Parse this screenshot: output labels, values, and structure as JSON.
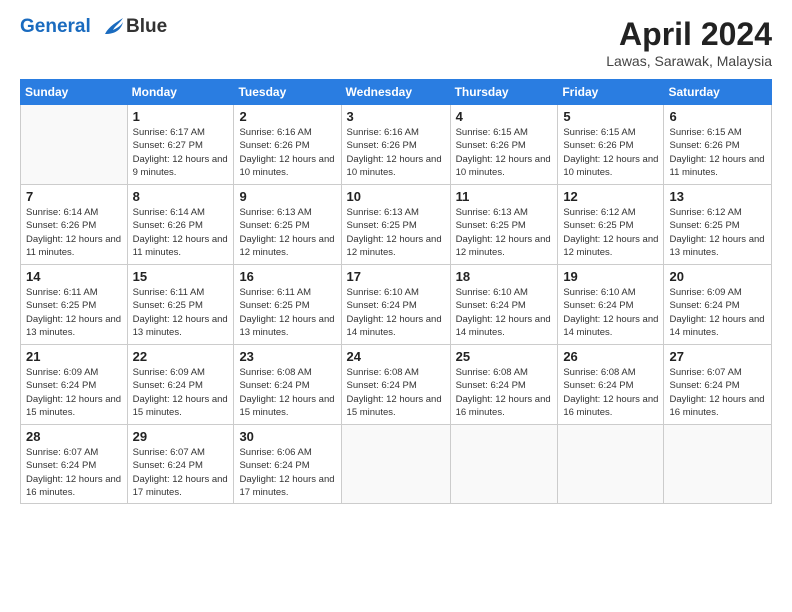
{
  "header": {
    "logo_line1": "General",
    "logo_line2": "Blue",
    "title": "April 2024",
    "subtitle": "Lawas, Sarawak, Malaysia"
  },
  "weekdays": [
    "Sunday",
    "Monday",
    "Tuesday",
    "Wednesday",
    "Thursday",
    "Friday",
    "Saturday"
  ],
  "weeks": [
    [
      {
        "day": "",
        "sunrise": "",
        "sunset": "",
        "daylight": ""
      },
      {
        "day": "1",
        "sunrise": "Sunrise: 6:17 AM",
        "sunset": "Sunset: 6:27 PM",
        "daylight": "Daylight: 12 hours and 9 minutes."
      },
      {
        "day": "2",
        "sunrise": "Sunrise: 6:16 AM",
        "sunset": "Sunset: 6:26 PM",
        "daylight": "Daylight: 12 hours and 10 minutes."
      },
      {
        "day": "3",
        "sunrise": "Sunrise: 6:16 AM",
        "sunset": "Sunset: 6:26 PM",
        "daylight": "Daylight: 12 hours and 10 minutes."
      },
      {
        "day": "4",
        "sunrise": "Sunrise: 6:15 AM",
        "sunset": "Sunset: 6:26 PM",
        "daylight": "Daylight: 12 hours and 10 minutes."
      },
      {
        "day": "5",
        "sunrise": "Sunrise: 6:15 AM",
        "sunset": "Sunset: 6:26 PM",
        "daylight": "Daylight: 12 hours and 10 minutes."
      },
      {
        "day": "6",
        "sunrise": "Sunrise: 6:15 AM",
        "sunset": "Sunset: 6:26 PM",
        "daylight": "Daylight: 12 hours and 11 minutes."
      }
    ],
    [
      {
        "day": "7",
        "sunrise": "Sunrise: 6:14 AM",
        "sunset": "Sunset: 6:26 PM",
        "daylight": "Daylight: 12 hours and 11 minutes."
      },
      {
        "day": "8",
        "sunrise": "Sunrise: 6:14 AM",
        "sunset": "Sunset: 6:26 PM",
        "daylight": "Daylight: 12 hours and 11 minutes."
      },
      {
        "day": "9",
        "sunrise": "Sunrise: 6:13 AM",
        "sunset": "Sunset: 6:25 PM",
        "daylight": "Daylight: 12 hours and 12 minutes."
      },
      {
        "day": "10",
        "sunrise": "Sunrise: 6:13 AM",
        "sunset": "Sunset: 6:25 PM",
        "daylight": "Daylight: 12 hours and 12 minutes."
      },
      {
        "day": "11",
        "sunrise": "Sunrise: 6:13 AM",
        "sunset": "Sunset: 6:25 PM",
        "daylight": "Daylight: 12 hours and 12 minutes."
      },
      {
        "day": "12",
        "sunrise": "Sunrise: 6:12 AM",
        "sunset": "Sunset: 6:25 PM",
        "daylight": "Daylight: 12 hours and 12 minutes."
      },
      {
        "day": "13",
        "sunrise": "Sunrise: 6:12 AM",
        "sunset": "Sunset: 6:25 PM",
        "daylight": "Daylight: 12 hours and 13 minutes."
      }
    ],
    [
      {
        "day": "14",
        "sunrise": "Sunrise: 6:11 AM",
        "sunset": "Sunset: 6:25 PM",
        "daylight": "Daylight: 12 hours and 13 minutes."
      },
      {
        "day": "15",
        "sunrise": "Sunrise: 6:11 AM",
        "sunset": "Sunset: 6:25 PM",
        "daylight": "Daylight: 12 hours and 13 minutes."
      },
      {
        "day": "16",
        "sunrise": "Sunrise: 6:11 AM",
        "sunset": "Sunset: 6:25 PM",
        "daylight": "Daylight: 12 hours and 13 minutes."
      },
      {
        "day": "17",
        "sunrise": "Sunrise: 6:10 AM",
        "sunset": "Sunset: 6:24 PM",
        "daylight": "Daylight: 12 hours and 14 minutes."
      },
      {
        "day": "18",
        "sunrise": "Sunrise: 6:10 AM",
        "sunset": "Sunset: 6:24 PM",
        "daylight": "Daylight: 12 hours and 14 minutes."
      },
      {
        "day": "19",
        "sunrise": "Sunrise: 6:10 AM",
        "sunset": "Sunset: 6:24 PM",
        "daylight": "Daylight: 12 hours and 14 minutes."
      },
      {
        "day": "20",
        "sunrise": "Sunrise: 6:09 AM",
        "sunset": "Sunset: 6:24 PM",
        "daylight": "Daylight: 12 hours and 14 minutes."
      }
    ],
    [
      {
        "day": "21",
        "sunrise": "Sunrise: 6:09 AM",
        "sunset": "Sunset: 6:24 PM",
        "daylight": "Daylight: 12 hours and 15 minutes."
      },
      {
        "day": "22",
        "sunrise": "Sunrise: 6:09 AM",
        "sunset": "Sunset: 6:24 PM",
        "daylight": "Daylight: 12 hours and 15 minutes."
      },
      {
        "day": "23",
        "sunrise": "Sunrise: 6:08 AM",
        "sunset": "Sunset: 6:24 PM",
        "daylight": "Daylight: 12 hours and 15 minutes."
      },
      {
        "day": "24",
        "sunrise": "Sunrise: 6:08 AM",
        "sunset": "Sunset: 6:24 PM",
        "daylight": "Daylight: 12 hours and 15 minutes."
      },
      {
        "day": "25",
        "sunrise": "Sunrise: 6:08 AM",
        "sunset": "Sunset: 6:24 PM",
        "daylight": "Daylight: 12 hours and 16 minutes."
      },
      {
        "day": "26",
        "sunrise": "Sunrise: 6:08 AM",
        "sunset": "Sunset: 6:24 PM",
        "daylight": "Daylight: 12 hours and 16 minutes."
      },
      {
        "day": "27",
        "sunrise": "Sunrise: 6:07 AM",
        "sunset": "Sunset: 6:24 PM",
        "daylight": "Daylight: 12 hours and 16 minutes."
      }
    ],
    [
      {
        "day": "28",
        "sunrise": "Sunrise: 6:07 AM",
        "sunset": "Sunset: 6:24 PM",
        "daylight": "Daylight: 12 hours and 16 minutes."
      },
      {
        "day": "29",
        "sunrise": "Sunrise: 6:07 AM",
        "sunset": "Sunset: 6:24 PM",
        "daylight": "Daylight: 12 hours and 17 minutes."
      },
      {
        "day": "30",
        "sunrise": "Sunrise: 6:06 AM",
        "sunset": "Sunset: 6:24 PM",
        "daylight": "Daylight: 12 hours and 17 minutes."
      },
      {
        "day": "",
        "sunrise": "",
        "sunset": "",
        "daylight": ""
      },
      {
        "day": "",
        "sunrise": "",
        "sunset": "",
        "daylight": ""
      },
      {
        "day": "",
        "sunrise": "",
        "sunset": "",
        "daylight": ""
      },
      {
        "day": "",
        "sunrise": "",
        "sunset": "",
        "daylight": ""
      }
    ]
  ]
}
